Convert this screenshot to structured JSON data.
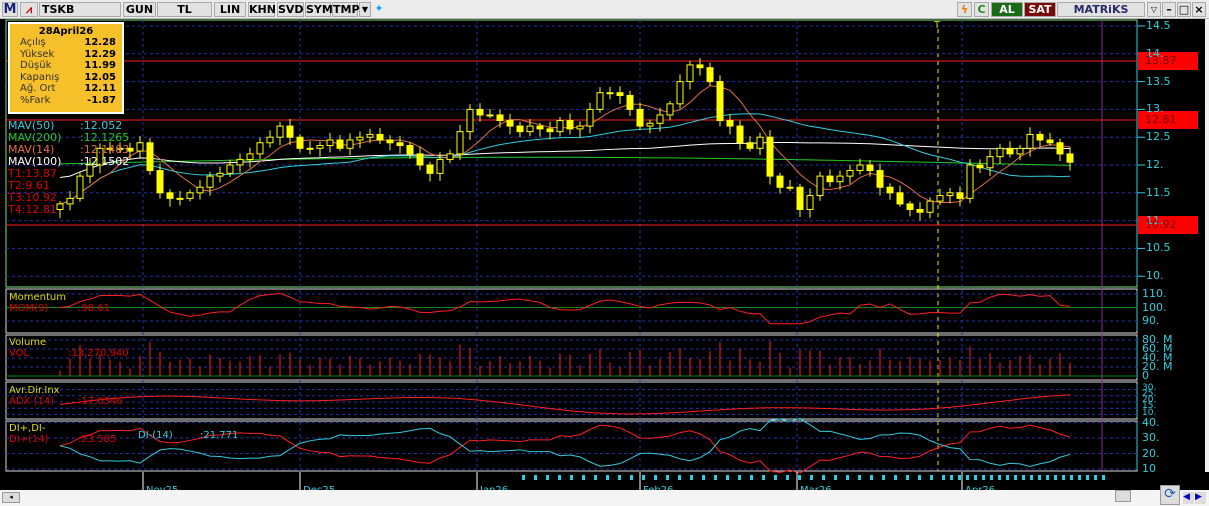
{
  "toolbar": {
    "logo": "M",
    "symbol": "TSKB",
    "period": "GUN",
    "currency": "TL",
    "scale": "LIN",
    "buttons": [
      "KHN",
      "SVD",
      "SYM",
      "TMP"
    ],
    "buy": "AL",
    "sell": "SAT",
    "brand": "MATRiKS"
  },
  "info_box": {
    "date": "28April26",
    "rows": [
      {
        "label": "Açılış",
        "value": "12.28"
      },
      {
        "label": "Yüksek",
        "value": "12.29"
      },
      {
        "label": "Düşük",
        "value": "11.99"
      },
      {
        "label": "Kapanış",
        "value": "12.05"
      },
      {
        "label": "Ağ. Ort",
        "value": "12.11"
      },
      {
        "label": "%Fark",
        "value": "-1.87"
      }
    ]
  },
  "legend": [
    {
      "name": "MAV(50)",
      "value": ":12.052",
      "color": "#33ccdd"
    },
    {
      "name": "MAV(200)",
      "value": ":12.1265",
      "color": "#22cc22"
    },
    {
      "name": "MAV(14)",
      "value": ":12.1483",
      "color": "#e07040"
    },
    {
      "name": "MAV(100)",
      "value": ":12.1502",
      "color": "#ffffff"
    }
  ],
  "targets": [
    "T1:13.87",
    "T2:9.61",
    "T3:10.92",
    "T4:12.81"
  ],
  "levels": [
    {
      "value": 13.87,
      "label": "13.87"
    },
    {
      "value": 12.81,
      "label": "12.81"
    },
    {
      "value": 10.92,
      "label": "10.92"
    }
  ],
  "price_axis": [
    "14.5",
    "14.",
    "13.5",
    "13.",
    "12.5",
    "12.",
    "11.5",
    "11.",
    "10.5",
    "10."
  ],
  "marker": "T",
  "momentum": {
    "title": "Momentum",
    "name": "MOM(9)",
    "value": ":98.61",
    "axis": [
      "110.",
      "100.",
      "90."
    ]
  },
  "volume": {
    "title": "Volume",
    "name": "VOL",
    "value": ":13,270,940",
    "axis": [
      "80. M",
      "60. M",
      "40. M",
      "20. M",
      "0"
    ]
  },
  "adx": {
    "title": "Avr.Dir.Inx",
    "name": "ADX (14)",
    "value": ":17.0346",
    "axis": [
      "30.",
      "25.",
      "20.",
      "15.",
      "10."
    ]
  },
  "di": {
    "title": "DI+,DI-",
    "plus_name": "DI+(14)",
    "plus_value": ":23.585",
    "minus_name": "DI-(14)",
    "minus_value": ":21.771",
    "axis": [
      "40.",
      "30.",
      "20.",
      "10"
    ]
  },
  "dates": [
    "Nov25",
    "Dec25",
    "Jan26",
    "Feb26",
    "Mar26",
    "Apr26"
  ],
  "chart_data": {
    "type": "candlestick",
    "symbol": "TSKB",
    "ylim": [
      10,
      14.5
    ],
    "closes": [
      11.3,
      11.4,
      11.8,
      12.0,
      12.3,
      12.3,
      12.3,
      12.25,
      12.4,
      11.9,
      11.5,
      11.4,
      11.4,
      11.5,
      11.6,
      11.8,
      11.85,
      12.0,
      12.1,
      12.2,
      12.4,
      12.5,
      12.7,
      12.5,
      12.3,
      12.3,
      12.35,
      12.45,
      12.3,
      12.45,
      12.5,
      12.55,
      12.45,
      12.4,
      12.35,
      12.2,
      12.0,
      11.85,
      12.1,
      12.2,
      12.6,
      13.0,
      12.9,
      12.9,
      12.8,
      12.7,
      12.6,
      12.7,
      12.65,
      12.6,
      12.8,
      12.65,
      12.7,
      13.0,
      13.3,
      13.3,
      13.25,
      13.0,
      12.7,
      12.75,
      12.9,
      13.1,
      13.5,
      13.8,
      13.75,
      13.5,
      12.8,
      12.7,
      12.4,
      12.3,
      12.5,
      11.8,
      11.6,
      11.6,
      11.2,
      11.45,
      11.8,
      11.7,
      11.8,
      11.9,
      12.0,
      11.9,
      11.6,
      11.5,
      11.3,
      11.2,
      11.15,
      11.35,
      11.45,
      11.5,
      11.4,
      12.0,
      11.95,
      12.15,
      12.3,
      12.2,
      12.3,
      12.55,
      12.45,
      12.4,
      12.2,
      12.05
    ]
  }
}
